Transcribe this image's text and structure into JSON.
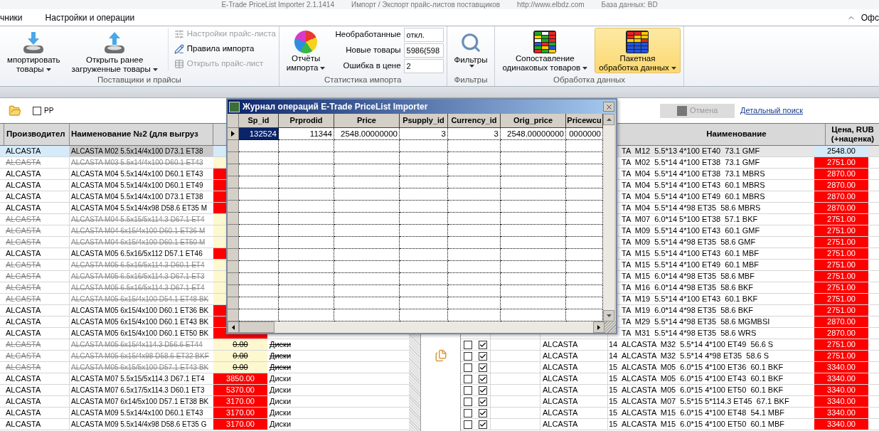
{
  "window": {
    "title_parts": [
      "E-Trade PriceList Importer 2.1.1414",
      "Импорт / Экспорт прайс-листов поставщиков",
      "http://www.elbdz.com",
      "База данных: BD"
    ]
  },
  "menu": {
    "tabs": [
      "чники",
      "Настройки и операции"
    ],
    "right_label": "Офс"
  },
  "ribbon": {
    "groups": [
      {
        "label": "Поставщики и прайсы",
        "big_buttons": [
          {
            "lines": [
              "мпортировать",
              "товары"
            ],
            "has_menu": true,
            "selected": false
          },
          {
            "lines": [
              "Открыть ранее",
              "загруженные товары"
            ],
            "has_menu": true,
            "selected": false
          }
        ],
        "small_buttons": [
          {
            "label": "Настройки прайс-листа",
            "disabled": true
          },
          {
            "label": "Правила импорта",
            "disabled": false
          },
          {
            "label": "Открыть прайс-лист",
            "disabled": true
          }
        ]
      },
      {
        "label": "Статистика импорта",
        "big_buttons": [
          {
            "lines": [
              "Отчёты",
              "импорта"
            ],
            "has_menu": true,
            "selected": false
          }
        ],
        "stats": [
          {
            "label": "Необработанные",
            "value": "откл."
          },
          {
            "label": "Новые товары",
            "value": "5986(598"
          },
          {
            "label": "Ошибка в цене",
            "value": "2"
          }
        ]
      },
      {
        "label": "Фильтры",
        "big_buttons": [
          {
            "lines": [
              "Фильтры"
            ],
            "has_menu": true,
            "selected": false
          }
        ]
      },
      {
        "label": "Обработка данных",
        "big_buttons": [
          {
            "lines": [
              "Сопоставление",
              "одинаковых товаров"
            ],
            "has_menu": true,
            "selected": false
          },
          {
            "lines": [
              "Пакетная",
              "обработка данных"
            ],
            "has_menu": true,
            "selected": true
          }
        ]
      }
    ]
  },
  "left_panel": {
    "checkbox": {
      "label": "PP",
      "checked": false
    },
    "columns": [
      "Производител",
      "Наименование №2 (для выгруз"
    ],
    "rows": [
      {
        "maker": "ALCASTA",
        "name": "ALCASTA M02 5.5x14/4x100 D73.1 ET38",
        "selected": true,
        "struck": false
      },
      {
        "maker": "ALCASTA",
        "name": "ALCASTA M03 5.5x14/4x100 D60.1 ET43",
        "selected": false,
        "struck": true
      },
      {
        "maker": "ALCASTA",
        "name": "ALCASTA M04 5.5x14/4x100 D60.1 ET43",
        "selected": false,
        "struck": false
      },
      {
        "maker": "ALCASTA",
        "name": "ALCASTA M04 5.5x14/4x100 D60.1 ET49",
        "selected": false,
        "struck": false
      },
      {
        "maker": "ALCASTA",
        "name": "ALCASTA M04 5.5x14/4x100 D73.1 ET38",
        "selected": false,
        "struck": false
      },
      {
        "maker": "ALCASTA",
        "name": "ALCASTA M04 5.5x14/4x98 D58.6 ET35 M",
        "selected": false,
        "struck": false
      },
      {
        "maker": "ALCASTA",
        "name": "ALCASTA M04 5.5x15/5x114.3 D67.1 ET4",
        "selected": false,
        "struck": true
      },
      {
        "maker": "ALCASTA",
        "name": "ALCASTA M04 6x15/4x100 D60.1 ET36 M",
        "selected": false,
        "struck": true
      },
      {
        "maker": "ALCASTA",
        "name": "ALCASTA M04 6x15/4x100 D60.1 ET50 M",
        "selected": false,
        "struck": true
      },
      {
        "maker": "ALCASTA",
        "name": "ALCASTA M05 6.5x16/5x112 D57.1 ET46",
        "selected": false,
        "struck": false
      },
      {
        "maker": "ALCASTA",
        "name": "ALCASTA M05 6.5x16/5x114.3 D60.1 ET4",
        "selected": false,
        "struck": true
      },
      {
        "maker": "ALCASTA",
        "name": "ALCASTA M05 6.5x16/5x114.3 D67.1 ET3",
        "selected": false,
        "struck": true
      },
      {
        "maker": "ALCASTA",
        "name": "ALCASTA M05 6.5x16/5x114.3 D67.1 ET4",
        "selected": false,
        "struck": true
      },
      {
        "maker": "ALCASTA",
        "name": "ALCASTA M05 6x15/4x100 D54.1 ET48 BK",
        "selected": false,
        "struck": true
      },
      {
        "maker": "ALCASTA",
        "name": "ALCASTA M05 6x15/4x100 D60.1 ET36 BK",
        "selected": false,
        "struck": false
      },
      {
        "maker": "ALCASTA",
        "name": "ALCASTA M05 6x15/4x100 D60.1 ET43 BK",
        "selected": false,
        "struck": false
      },
      {
        "maker": "ALCASTA",
        "name": "ALCASTA M05 6x15/4x100 D60.1 ET50 BK",
        "selected": false,
        "struck": false
      },
      {
        "maker": "ALCASTA",
        "name": "ALCASTA M05 6x15/4x114.3 D56.6 ET44",
        "selected": false,
        "struck": true,
        "price": "0.00",
        "category": "Диски"
      },
      {
        "maker": "ALCASTA",
        "name": "ALCASTA M05 6x15/4x98 D58.6 ET32 BKF",
        "selected": false,
        "struck": true,
        "price": "0.00",
        "category": "Диски"
      },
      {
        "maker": "ALCASTA",
        "name": "ALCASTA M05 6x15/5x100 D57.1 ET43 BK",
        "selected": false,
        "struck": true,
        "price": "0.00",
        "category": "Диски"
      },
      {
        "maker": "ALCASTA",
        "name": "ALCASTA M07 5.5x15/5x114.3 D67.1 ET4",
        "selected": false,
        "struck": false,
        "price": "3850.00",
        "category": "Диски"
      },
      {
        "maker": "ALCASTA",
        "name": "ALCASTA M07 6.5x17/5x114.3 D60.1 ET3",
        "selected": false,
        "struck": false,
        "price": "5370.00",
        "category": "Диски"
      },
      {
        "maker": "ALCASTA",
        "name": "ALCASTA M07 6x14/5x100 D57.1 ET38 BK",
        "selected": false,
        "struck": false,
        "price": "3170.00",
        "category": "Диски"
      },
      {
        "maker": "ALCASTA",
        "name": "ALCASTA M09 5.5x14/4x100 D60.1 ET43",
        "selected": false,
        "struck": false,
        "price": "3170.00",
        "category": "Диски"
      },
      {
        "maker": "ALCASTA",
        "name": "ALCASTA M09 5.5x14/4x98 D58.6 ET35 G",
        "selected": false,
        "struck": false,
        "price": "3170.00",
        "category": "Диски"
      }
    ]
  },
  "right_panel": {
    "cancel_button": {
      "label": "Отмена",
      "disabled": true
    },
    "search_link": "Детальный поиск",
    "columns": [
      "Наименование",
      "Цена, RUB (+наценка)"
    ],
    "rows": [
      {
        "name": "TA  M12  5.5*13 4*100 ET40  73.1 GMF",
        "price": "2548.00",
        "selected": true
      },
      {
        "name": "TA  M02  5.5*14 4*100 ET38  73.1 GMF",
        "price": "2751.00",
        "selected": false
      },
      {
        "name": "TA  M04  5.5*14 4*100 ET38  73.1 MBRS",
        "price": "2870.00",
        "selected": false
      },
      {
        "name": "TA  M04  5.5*14 4*100 ET43  60.1 MBRS",
        "price": "2870.00",
        "selected": false
      },
      {
        "name": "TA  M04  5.5*14 4*100 ET49  60.1 MBRS",
        "price": "2870.00",
        "selected": false
      },
      {
        "name": "TA  M04  5.5*14 4*98 ET35  58.6 MBRS",
        "price": "2870.00",
        "selected": false
      },
      {
        "name": "TA  M07  6.0*14 5*100 ET38  57.1 BKF",
        "price": "2751.00",
        "selected": false
      },
      {
        "name": "TA  M09  5.5*14 4*100 ET43  60.1 GMF",
        "price": "2751.00",
        "selected": false
      },
      {
        "name": "TA  M09  5.5*14 4*98 ET35  58.6 GMF",
        "price": "2751.00",
        "selected": false
      },
      {
        "name": "TA  M15  5.5*14 4*100 ET43  60.1 MBF",
        "price": "2751.00",
        "selected": false
      },
      {
        "name": "TA  M15  5.5*14 4*100 ET49  60.1 MBF",
        "price": "2751.00",
        "selected": false
      },
      {
        "name": "TA  M15  6.0*14 4*98 ET35  58.6 MBF",
        "price": "2751.00",
        "selected": false
      },
      {
        "name": "TA  M16  6.0*14 4*98 ET35  58.6 BKF",
        "price": "2751.00",
        "selected": false
      },
      {
        "name": "TA  M19  5.5*14 4*100 ET43  60.1 BKF",
        "price": "2751.00",
        "selected": false
      },
      {
        "name": "TA  M19  6.0*14 4*98 ET35  58.6 BKF",
        "price": "2751.00",
        "selected": false
      },
      {
        "name": "TA  M29  5.5*14 4*98 ET35  58.6 MGMBSI",
        "price": "2870.00",
        "selected": false
      },
      {
        "name": "TA  M31  5.5*14 4*98 ET35  58.6 WRS",
        "price": "2870.00",
        "selected": false
      },
      {
        "mark_a": false,
        "mark_b": true,
        "maker": "ALCASTA",
        "size": "14",
        "name": "ALCASTA  M32  5.5*14 4*100 ET49  56.6 S",
        "price": "2751.00",
        "selected": false
      },
      {
        "mark_a": false,
        "mark_b": true,
        "maker": "ALCASTA",
        "size": "14",
        "name": "ALCASTA  M32  5.5*14 4*98 ET35  58.6 S",
        "price": "2751.00",
        "selected": false
      },
      {
        "mark_a": false,
        "mark_b": true,
        "maker": "ALCASTA",
        "size": "15",
        "name": "ALCASTA  M05  6.0*15 4*100 ET36  60.1 BKF",
        "price": "3340.00",
        "selected": false
      },
      {
        "mark_a": false,
        "mark_b": true,
        "maker": "ALCASTA",
        "size": "15",
        "name": "ALCASTA  M05  6.0*15 4*100 ET43  60.1 BKF",
        "price": "3340.00",
        "selected": false
      },
      {
        "mark_a": false,
        "mark_b": true,
        "maker": "ALCASTA",
        "size": "15",
        "name": "ALCASTA  M05  6.0*15 4*100 ET50  60.1 BKF",
        "price": "3340.00",
        "selected": false
      },
      {
        "mark_a": false,
        "mark_b": true,
        "maker": "ALCASTA",
        "size": "15",
        "name": "ALCASTA  M07  5.5*15 5*114.3 ET45  67.1 BKF",
        "price": "3340.00",
        "selected": false
      },
      {
        "mark_a": false,
        "mark_b": true,
        "maker": "ALCASTA",
        "size": "15",
        "name": "ALCASTA  M15  6.0*15 4*100 ET48  54.1 MBF",
        "price": "3340.00",
        "selected": false
      },
      {
        "mark_a": false,
        "mark_b": true,
        "maker": "ALCASTA",
        "size": "15",
        "name": "ALCASTA  M15  6.0*15 4*100 ET50  60.1 MBF",
        "price": "3340.00",
        "selected": false
      }
    ]
  },
  "dialog": {
    "title": "Журнал операций E-Trade PriceList Importer",
    "columns": [
      "Sp_id",
      "Prprodid",
      "Price",
      "Psupply_id",
      "Currency_id",
      "Orig_price",
      "Pricewcu"
    ],
    "rows": [
      {
        "current": true,
        "cells": [
          {
            "text": "132524",
            "selected": true
          },
          {
            "text": "11344",
            "selected": false
          },
          {
            "text": "2548.00000000",
            "selected": false
          },
          {
            "text": "3",
            "selected": false
          },
          {
            "text": "3",
            "selected": false
          },
          {
            "text": "2548.00000000",
            "selected": false
          },
          {
            "text": "0000000",
            "selected": false
          }
        ]
      }
    ]
  }
}
